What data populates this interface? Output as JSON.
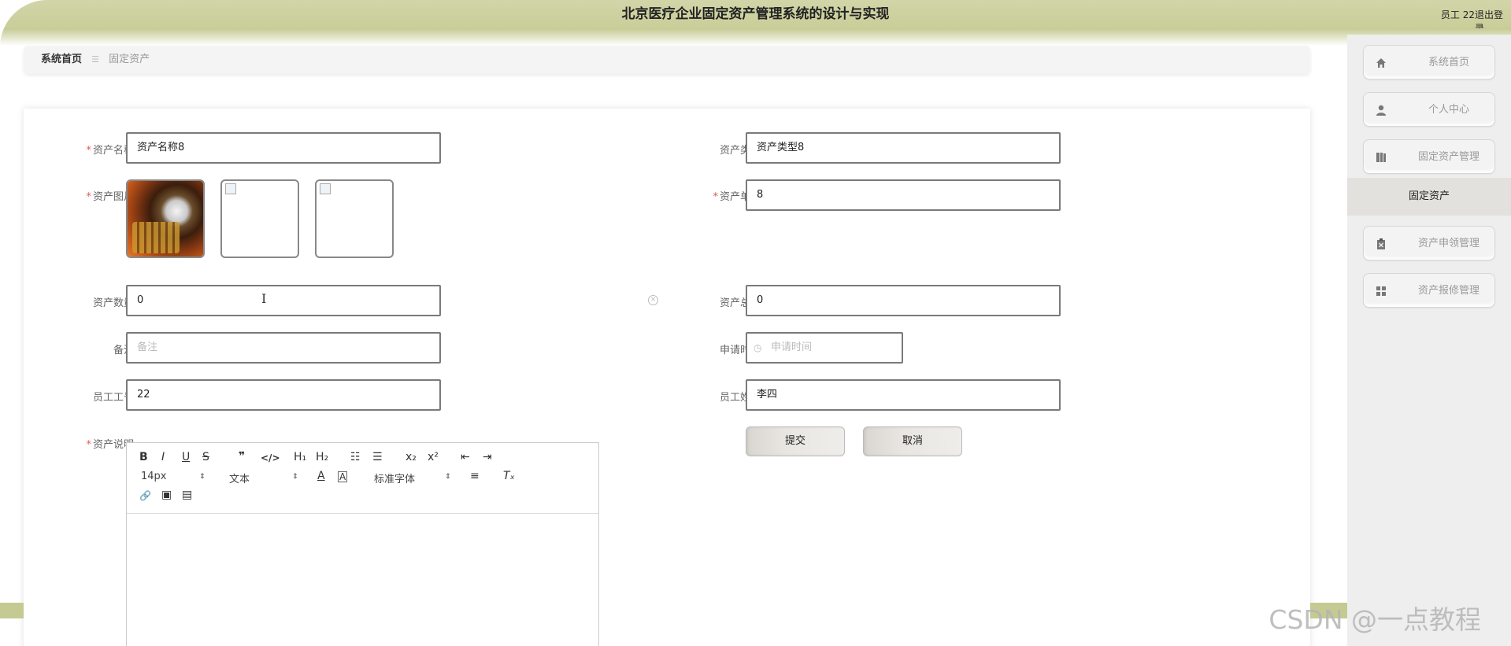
{
  "header": {
    "title": "北京医疗企业固定资产管理系统的设计与实现",
    "user": "员工 22",
    "logout": "退出登录"
  },
  "breadcrumb": {
    "home": "系统首页",
    "separator": "☰",
    "current": "固定资产"
  },
  "form": {
    "asset_name": {
      "label": "资产名称",
      "value": "资产名称8"
    },
    "asset_type": {
      "label": "资产类型",
      "value": "资产类型8"
    },
    "asset_image": {
      "label": "资产图片"
    },
    "unit_price": {
      "label": "资产单价",
      "value": "8"
    },
    "quantity": {
      "label": "资产数量",
      "value": "0"
    },
    "total_price": {
      "label": "资产总价",
      "value": "0"
    },
    "remark": {
      "label": "备注",
      "placeholder": "备注"
    },
    "apply_time": {
      "label": "申请时间",
      "placeholder": "申请时间"
    },
    "employee_no": {
      "label": "员工工号",
      "value": "22"
    },
    "employee_name": {
      "label": "员工姓名",
      "value": "李四"
    },
    "description": {
      "label": "资产说明"
    },
    "required_mark": "*",
    "submit": "提交",
    "cancel": "取消"
  },
  "editor": {
    "font_size": "14px",
    "text_style": "文本",
    "font_family": "标准字体",
    "buttons": {
      "bold": "B",
      "italic": "I",
      "underline": "U",
      "strike": "S",
      "quote": "❞",
      "code": "</>",
      "h1": "H₁",
      "h2": "H₂",
      "ol": "☷",
      "ul": "☰",
      "sub": "x₂",
      "sup": "x²",
      "outdent": "⇤",
      "indent": "⇥",
      "color": "A",
      "bg": "A",
      "align": "≡",
      "clear": "Tₓ",
      "link": "🔗",
      "image": "▣",
      "video": "▤"
    },
    "arrow": "⇕"
  },
  "sidebar": {
    "items": [
      {
        "label": "系统首页",
        "icon": "home-icon"
      },
      {
        "label": "个人中心",
        "icon": "user-icon"
      },
      {
        "label": "固定资产管理",
        "icon": "book-icon"
      },
      {
        "label": "资产申领管理",
        "icon": "clipboard-icon"
      },
      {
        "label": "资产报修管理",
        "icon": "grid-icon"
      }
    ],
    "sub_item": "固定资产"
  },
  "watermark": "CSDN @一点教程",
  "colors": {
    "header": "#c5ca92",
    "required": "#e05a4f",
    "sidebar": "#eeeeee"
  }
}
